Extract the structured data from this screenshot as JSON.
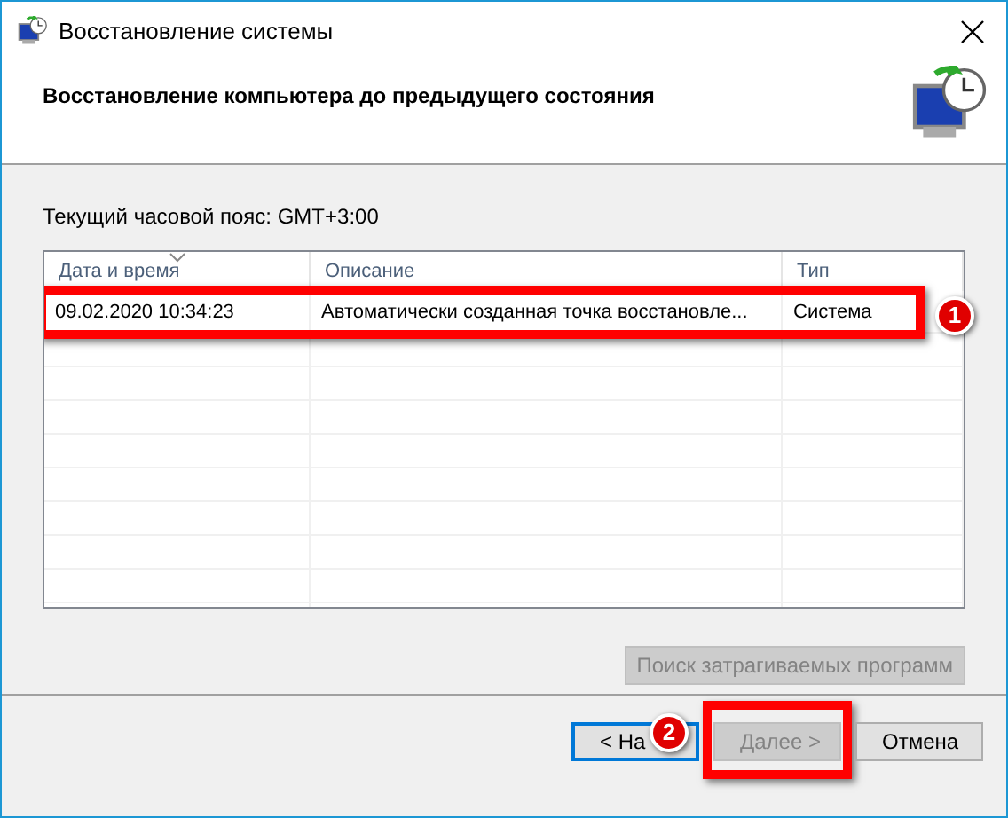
{
  "window": {
    "title": "Восстановление системы"
  },
  "header": {
    "title": "Восстановление компьютера до предыдущего состояния"
  },
  "timezone_label": "Текущий часовой пояс: GMT+3:00",
  "table": {
    "columns": [
      {
        "label": "Дата и время",
        "sorted": true
      },
      {
        "label": "Описание",
        "sorted": false
      },
      {
        "label": "Тип",
        "sorted": false
      }
    ],
    "rows": [
      {
        "cells": [
          "09.02.2020 10:34:23",
          "Автоматически созданная точка восстановле...",
          "Система"
        ],
        "highlighted": true,
        "badge": "1"
      }
    ]
  },
  "scan_button": {
    "label": "Поиск затрагиваемых программ",
    "disabled": true
  },
  "buttons": [
    {
      "label": "< На",
      "disabled": false,
      "focused": true,
      "highlighted": false
    },
    {
      "label": "Далее >",
      "disabled": true,
      "focused": false,
      "highlighted": true
    },
    {
      "label": "Отмена",
      "disabled": false,
      "focused": false,
      "highlighted": false
    }
  ],
  "back_badge": "2"
}
